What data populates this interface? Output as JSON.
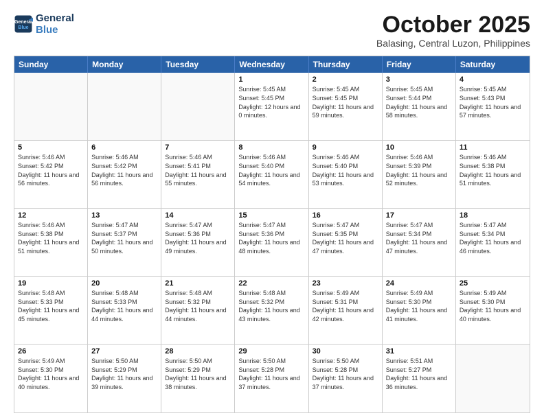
{
  "logo": {
    "line1": "General",
    "line2": "Blue"
  },
  "title": "October 2025",
  "subtitle": "Balasing, Central Luzon, Philippines",
  "header_days": [
    "Sunday",
    "Monday",
    "Tuesday",
    "Wednesday",
    "Thursday",
    "Friday",
    "Saturday"
  ],
  "weeks": [
    [
      {
        "day": "",
        "sunrise": "",
        "sunset": "",
        "daylight": "",
        "empty": true
      },
      {
        "day": "",
        "sunrise": "",
        "sunset": "",
        "daylight": "",
        "empty": true
      },
      {
        "day": "",
        "sunrise": "",
        "sunset": "",
        "daylight": "",
        "empty": true
      },
      {
        "day": "1",
        "sunrise": "Sunrise: 5:45 AM",
        "sunset": "Sunset: 5:45 PM",
        "daylight": "Daylight: 12 hours and 0 minutes."
      },
      {
        "day": "2",
        "sunrise": "Sunrise: 5:45 AM",
        "sunset": "Sunset: 5:45 PM",
        "daylight": "Daylight: 11 hours and 59 minutes."
      },
      {
        "day": "3",
        "sunrise": "Sunrise: 5:45 AM",
        "sunset": "Sunset: 5:44 PM",
        "daylight": "Daylight: 11 hours and 58 minutes."
      },
      {
        "day": "4",
        "sunrise": "Sunrise: 5:45 AM",
        "sunset": "Sunset: 5:43 PM",
        "daylight": "Daylight: 11 hours and 57 minutes."
      }
    ],
    [
      {
        "day": "5",
        "sunrise": "Sunrise: 5:46 AM",
        "sunset": "Sunset: 5:42 PM",
        "daylight": "Daylight: 11 hours and 56 minutes."
      },
      {
        "day": "6",
        "sunrise": "Sunrise: 5:46 AM",
        "sunset": "Sunset: 5:42 PM",
        "daylight": "Daylight: 11 hours and 56 minutes."
      },
      {
        "day": "7",
        "sunrise": "Sunrise: 5:46 AM",
        "sunset": "Sunset: 5:41 PM",
        "daylight": "Daylight: 11 hours and 55 minutes."
      },
      {
        "day": "8",
        "sunrise": "Sunrise: 5:46 AM",
        "sunset": "Sunset: 5:40 PM",
        "daylight": "Daylight: 11 hours and 54 minutes."
      },
      {
        "day": "9",
        "sunrise": "Sunrise: 5:46 AM",
        "sunset": "Sunset: 5:40 PM",
        "daylight": "Daylight: 11 hours and 53 minutes."
      },
      {
        "day": "10",
        "sunrise": "Sunrise: 5:46 AM",
        "sunset": "Sunset: 5:39 PM",
        "daylight": "Daylight: 11 hours and 52 minutes."
      },
      {
        "day": "11",
        "sunrise": "Sunrise: 5:46 AM",
        "sunset": "Sunset: 5:38 PM",
        "daylight": "Daylight: 11 hours and 51 minutes."
      }
    ],
    [
      {
        "day": "12",
        "sunrise": "Sunrise: 5:46 AM",
        "sunset": "Sunset: 5:38 PM",
        "daylight": "Daylight: 11 hours and 51 minutes."
      },
      {
        "day": "13",
        "sunrise": "Sunrise: 5:47 AM",
        "sunset": "Sunset: 5:37 PM",
        "daylight": "Daylight: 11 hours and 50 minutes."
      },
      {
        "day": "14",
        "sunrise": "Sunrise: 5:47 AM",
        "sunset": "Sunset: 5:36 PM",
        "daylight": "Daylight: 11 hours and 49 minutes."
      },
      {
        "day": "15",
        "sunrise": "Sunrise: 5:47 AM",
        "sunset": "Sunset: 5:36 PM",
        "daylight": "Daylight: 11 hours and 48 minutes."
      },
      {
        "day": "16",
        "sunrise": "Sunrise: 5:47 AM",
        "sunset": "Sunset: 5:35 PM",
        "daylight": "Daylight: 11 hours and 47 minutes."
      },
      {
        "day": "17",
        "sunrise": "Sunrise: 5:47 AM",
        "sunset": "Sunset: 5:34 PM",
        "daylight": "Daylight: 11 hours and 47 minutes."
      },
      {
        "day": "18",
        "sunrise": "Sunrise: 5:47 AM",
        "sunset": "Sunset: 5:34 PM",
        "daylight": "Daylight: 11 hours and 46 minutes."
      }
    ],
    [
      {
        "day": "19",
        "sunrise": "Sunrise: 5:48 AM",
        "sunset": "Sunset: 5:33 PM",
        "daylight": "Daylight: 11 hours and 45 minutes."
      },
      {
        "day": "20",
        "sunrise": "Sunrise: 5:48 AM",
        "sunset": "Sunset: 5:33 PM",
        "daylight": "Daylight: 11 hours and 44 minutes."
      },
      {
        "day": "21",
        "sunrise": "Sunrise: 5:48 AM",
        "sunset": "Sunset: 5:32 PM",
        "daylight": "Daylight: 11 hours and 44 minutes."
      },
      {
        "day": "22",
        "sunrise": "Sunrise: 5:48 AM",
        "sunset": "Sunset: 5:32 PM",
        "daylight": "Daylight: 11 hours and 43 minutes."
      },
      {
        "day": "23",
        "sunrise": "Sunrise: 5:49 AM",
        "sunset": "Sunset: 5:31 PM",
        "daylight": "Daylight: 11 hours and 42 minutes."
      },
      {
        "day": "24",
        "sunrise": "Sunrise: 5:49 AM",
        "sunset": "Sunset: 5:30 PM",
        "daylight": "Daylight: 11 hours and 41 minutes."
      },
      {
        "day": "25",
        "sunrise": "Sunrise: 5:49 AM",
        "sunset": "Sunset: 5:30 PM",
        "daylight": "Daylight: 11 hours and 40 minutes."
      }
    ],
    [
      {
        "day": "26",
        "sunrise": "Sunrise: 5:49 AM",
        "sunset": "Sunset: 5:30 PM",
        "daylight": "Daylight: 11 hours and 40 minutes."
      },
      {
        "day": "27",
        "sunrise": "Sunrise: 5:50 AM",
        "sunset": "Sunset: 5:29 PM",
        "daylight": "Daylight: 11 hours and 39 minutes."
      },
      {
        "day": "28",
        "sunrise": "Sunrise: 5:50 AM",
        "sunset": "Sunset: 5:29 PM",
        "daylight": "Daylight: 11 hours and 38 minutes."
      },
      {
        "day": "29",
        "sunrise": "Sunrise: 5:50 AM",
        "sunset": "Sunset: 5:28 PM",
        "daylight": "Daylight: 11 hours and 37 minutes."
      },
      {
        "day": "30",
        "sunrise": "Sunrise: 5:50 AM",
        "sunset": "Sunset: 5:28 PM",
        "daylight": "Daylight: 11 hours and 37 minutes."
      },
      {
        "day": "31",
        "sunrise": "Sunrise: 5:51 AM",
        "sunset": "Sunset: 5:27 PM",
        "daylight": "Daylight: 11 hours and 36 minutes."
      },
      {
        "day": "",
        "sunrise": "",
        "sunset": "",
        "daylight": "",
        "empty": true
      }
    ]
  ]
}
